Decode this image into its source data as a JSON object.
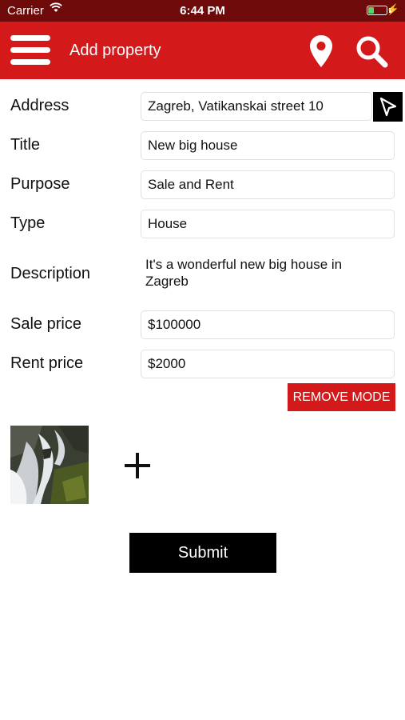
{
  "status_bar": {
    "carrier": "Carrier",
    "time": "6:44 PM",
    "battery_level": 0.35
  },
  "navbar": {
    "title": "Add property",
    "background": "#d4191b",
    "icons": [
      "menu-icon",
      "location-pin-icon",
      "search-icon"
    ]
  },
  "form": {
    "address": {
      "label": "Address",
      "value": "Zagreb, Vatikanskai street 10"
    },
    "title": {
      "label": "Title",
      "value": "New big house"
    },
    "purpose": {
      "label": "Purpose",
      "value": "Sale and Rent"
    },
    "type": {
      "label": "Type",
      "value": "House"
    },
    "description": {
      "label": "Description",
      "value": "It's a wonderful new big house in Zagreb"
    },
    "sale_price": {
      "label": "Sale price",
      "value": "$100000"
    },
    "rent_price": {
      "label": "Rent price",
      "value": "$2000"
    }
  },
  "remove_mode_label": "REMOVE MODE",
  "submit_label": "Submit",
  "colors": {
    "accent": "#d4191b",
    "status_bar": "#6e0a0a",
    "button_dark": "#000000"
  }
}
